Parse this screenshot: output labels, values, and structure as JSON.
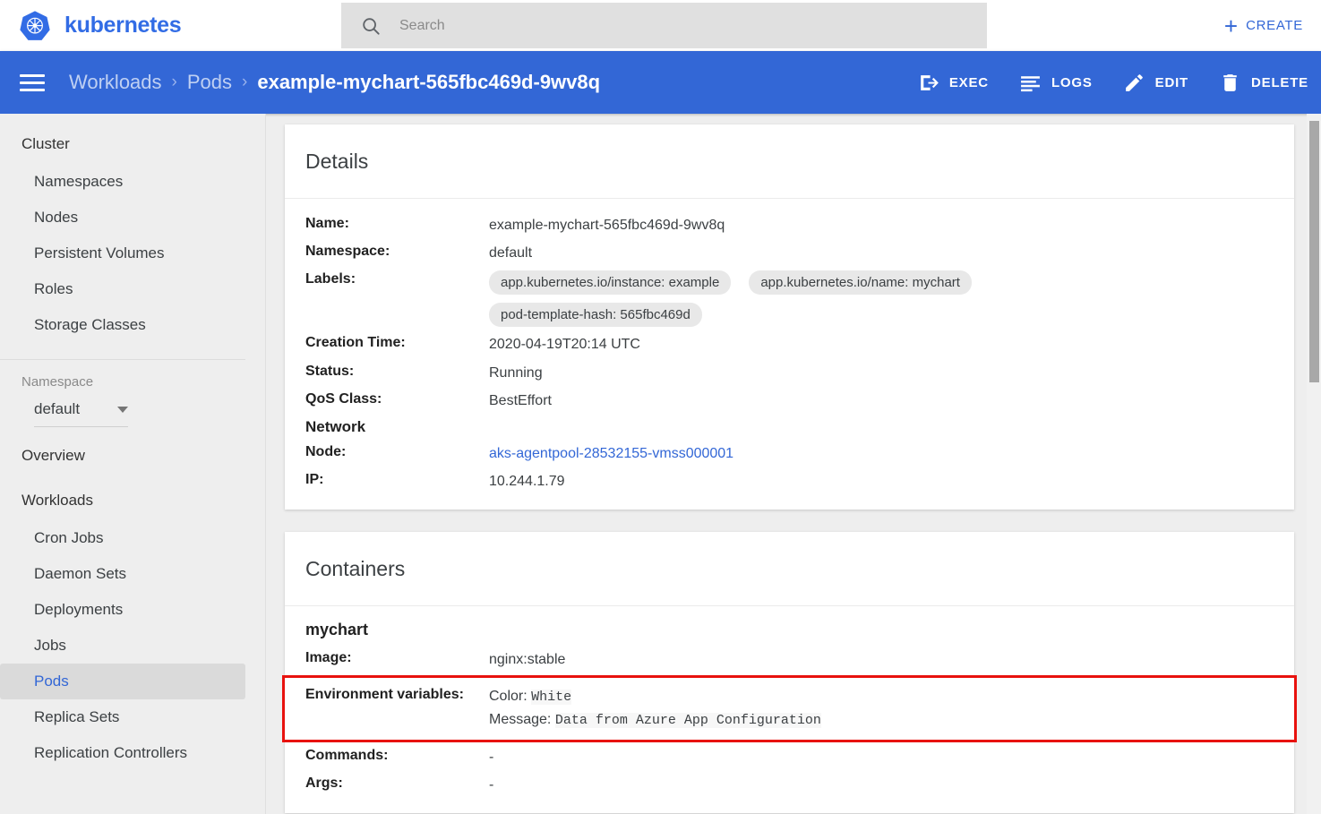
{
  "header": {
    "brand": "kubernetes",
    "logo_icon": "kubernetes-helm-logo",
    "search": {
      "icon": "search-icon",
      "placeholder": "Search",
      "value": ""
    },
    "create_button": {
      "icon": "plus-icon",
      "label": "CREATE"
    },
    "brand_color": "#326ce5"
  },
  "toolbar": {
    "menu_icon": "hamburger-menu-icon",
    "background_color": "#3367d6",
    "breadcrumb": {
      "items": [
        "Workloads",
        "Pods"
      ],
      "separator": "›",
      "current": "example-mychart-565fbc469d-9wv8q"
    },
    "actions": [
      {
        "label": "EXEC",
        "icon": "exec-terminal-icon"
      },
      {
        "label": "LOGS",
        "icon": "logs-lines-icon"
      },
      {
        "label": "EDIT",
        "icon": "pencil-edit-icon"
      },
      {
        "label": "DELETE",
        "icon": "trash-delete-icon"
      }
    ]
  },
  "sidebar": {
    "groups": [
      {
        "title": "Cluster",
        "items": [
          {
            "label": "Namespaces",
            "active": false
          },
          {
            "label": "Nodes",
            "active": false
          },
          {
            "label": "Persistent Volumes",
            "active": false
          },
          {
            "label": "Roles",
            "active": false
          },
          {
            "label": "Storage Classes",
            "active": false
          }
        ]
      }
    ],
    "namespace_selector": {
      "label": "Namespace",
      "value": "default",
      "caret_icon": "chevron-down-icon"
    },
    "overview": {
      "label": "Overview"
    },
    "workloads": {
      "title": "Workloads",
      "items": [
        {
          "label": "Cron Jobs",
          "active": false
        },
        {
          "label": "Daemon Sets",
          "active": false
        },
        {
          "label": "Deployments",
          "active": false
        },
        {
          "label": "Jobs",
          "active": false
        },
        {
          "label": "Pods",
          "active": true
        },
        {
          "label": "Replica Sets",
          "active": false
        },
        {
          "label": "Replication Controllers",
          "active": false
        }
      ]
    },
    "active_color": "#3367d6"
  },
  "details_card": {
    "title": "Details",
    "rows": [
      {
        "key": "Name:",
        "value": "example-mychart-565fbc469d-9wv8q"
      },
      {
        "key": "Namespace:",
        "value": "default"
      }
    ],
    "labels_key": "Labels:",
    "labels": [
      "app.kubernetes.io/instance: example",
      "app.kubernetes.io/name: mychart",
      "pod-template-hash: 565fbc469d"
    ],
    "rows2": [
      {
        "key": "Creation Time:",
        "value": "2020-04-19T20:14 UTC"
      },
      {
        "key": "Status:",
        "value": "Running"
      },
      {
        "key": "QoS Class:",
        "value": "BestEffort"
      }
    ],
    "network_heading": "Network",
    "node": {
      "key": "Node:",
      "value": "aks-agentpool-28532155-vmss000001",
      "is_link": true
    },
    "ip": {
      "key": "IP:",
      "value": "10.244.1.79"
    }
  },
  "containers_card": {
    "title": "Containers",
    "container_name": "mychart",
    "image": {
      "key": "Image:",
      "value": "nginx:stable"
    },
    "env": {
      "key": "Environment variables:",
      "highlight_color": "#e8120e",
      "variables": [
        {
          "name": "Color:",
          "value": "White"
        },
        {
          "name": "Message:",
          "value": "Data from Azure App Configuration"
        }
      ]
    },
    "commands": {
      "key": "Commands:",
      "value": "-"
    },
    "args": {
      "key": "Args:",
      "value": "-"
    }
  },
  "scrollbar": {
    "name": "vertical-scrollbar"
  }
}
